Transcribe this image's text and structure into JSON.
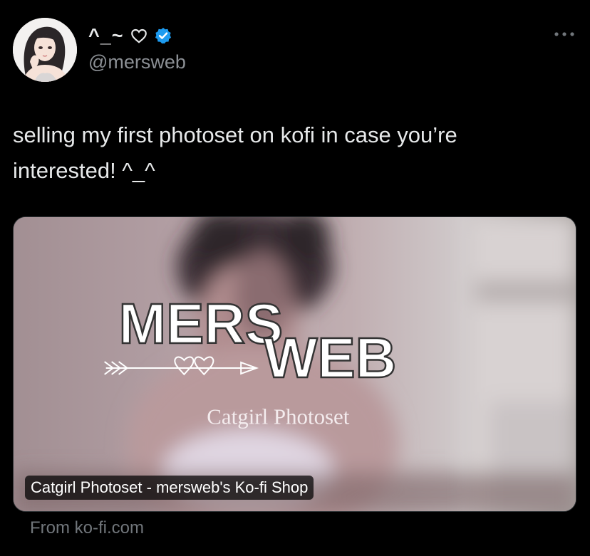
{
  "author": {
    "display_name": "^_~",
    "handle": "@mersweb"
  },
  "tweet": {
    "text_line1": "selling my first photoset on kofi in case you’re",
    "text_line2": "interested! ^_^"
  },
  "card": {
    "logo_top": "MERS",
    "logo_bottom": "WEB",
    "subtitle": "Catgirl Photoset",
    "title": "Catgirl Photoset - mersweb's Ko-fi Shop",
    "source": "From ko-fi.com"
  },
  "icons": {
    "heart": "heart-outline-icon",
    "verified": "verified-badge-icon",
    "more": "more-dots-icon"
  },
  "colors": {
    "background": "#000000",
    "text": "#e7e9ea",
    "muted": "#71767b",
    "verified": "#1d9bf0"
  }
}
